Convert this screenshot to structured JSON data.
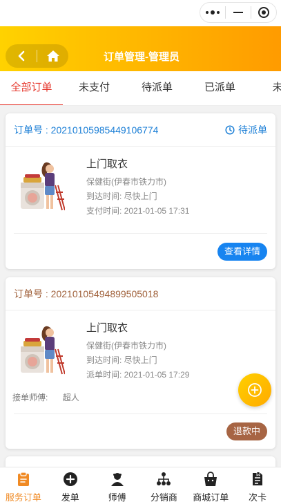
{
  "header": {
    "title": "订单管理-管理员"
  },
  "tabs": [
    {
      "label": "全部订单",
      "active": true
    },
    {
      "label": "未支付",
      "active": false
    },
    {
      "label": "待派单",
      "active": false
    },
    {
      "label": "已派单",
      "active": false
    },
    {
      "label": "未评",
      "active": false
    }
  ],
  "orders": [
    {
      "order_no": "订单号 : 20210105985449106774",
      "status": "待派单",
      "service": "上门取衣",
      "address": "保健街(伊春市铁力市)",
      "arrival": "到达时间:  尽快上门",
      "time_line": "支付时间:  2021-01-05 17:31",
      "button": "查看详情"
    },
    {
      "order_no": "订单号 : 20210105494899505018",
      "service": "上门取衣",
      "address": "保健街(伊春市铁力市)",
      "arrival": "到达时间:  尽快上门",
      "time_line": "派单时间:  2021-01-05 17:29",
      "master_label": "接单师傅:",
      "master_name": "超人",
      "button": "退款中"
    }
  ],
  "bottom_nav": [
    {
      "label": "服务订单",
      "icon": "clipboard-icon",
      "active": true
    },
    {
      "label": "发单",
      "icon": "plus-circle-icon",
      "active": false
    },
    {
      "label": "师傅",
      "icon": "worker-icon",
      "active": false
    },
    {
      "label": "分销商",
      "icon": "network-icon",
      "active": false
    },
    {
      "label": "商城订单",
      "icon": "bag-icon",
      "active": false
    },
    {
      "label": "次卡",
      "icon": "card-icon",
      "active": false
    }
  ],
  "colors": {
    "accent": "#ffb400",
    "active_tab": "#e5362b",
    "blue": "#1784f0",
    "brown": "#a76544",
    "nav_active": "#f08a24"
  }
}
